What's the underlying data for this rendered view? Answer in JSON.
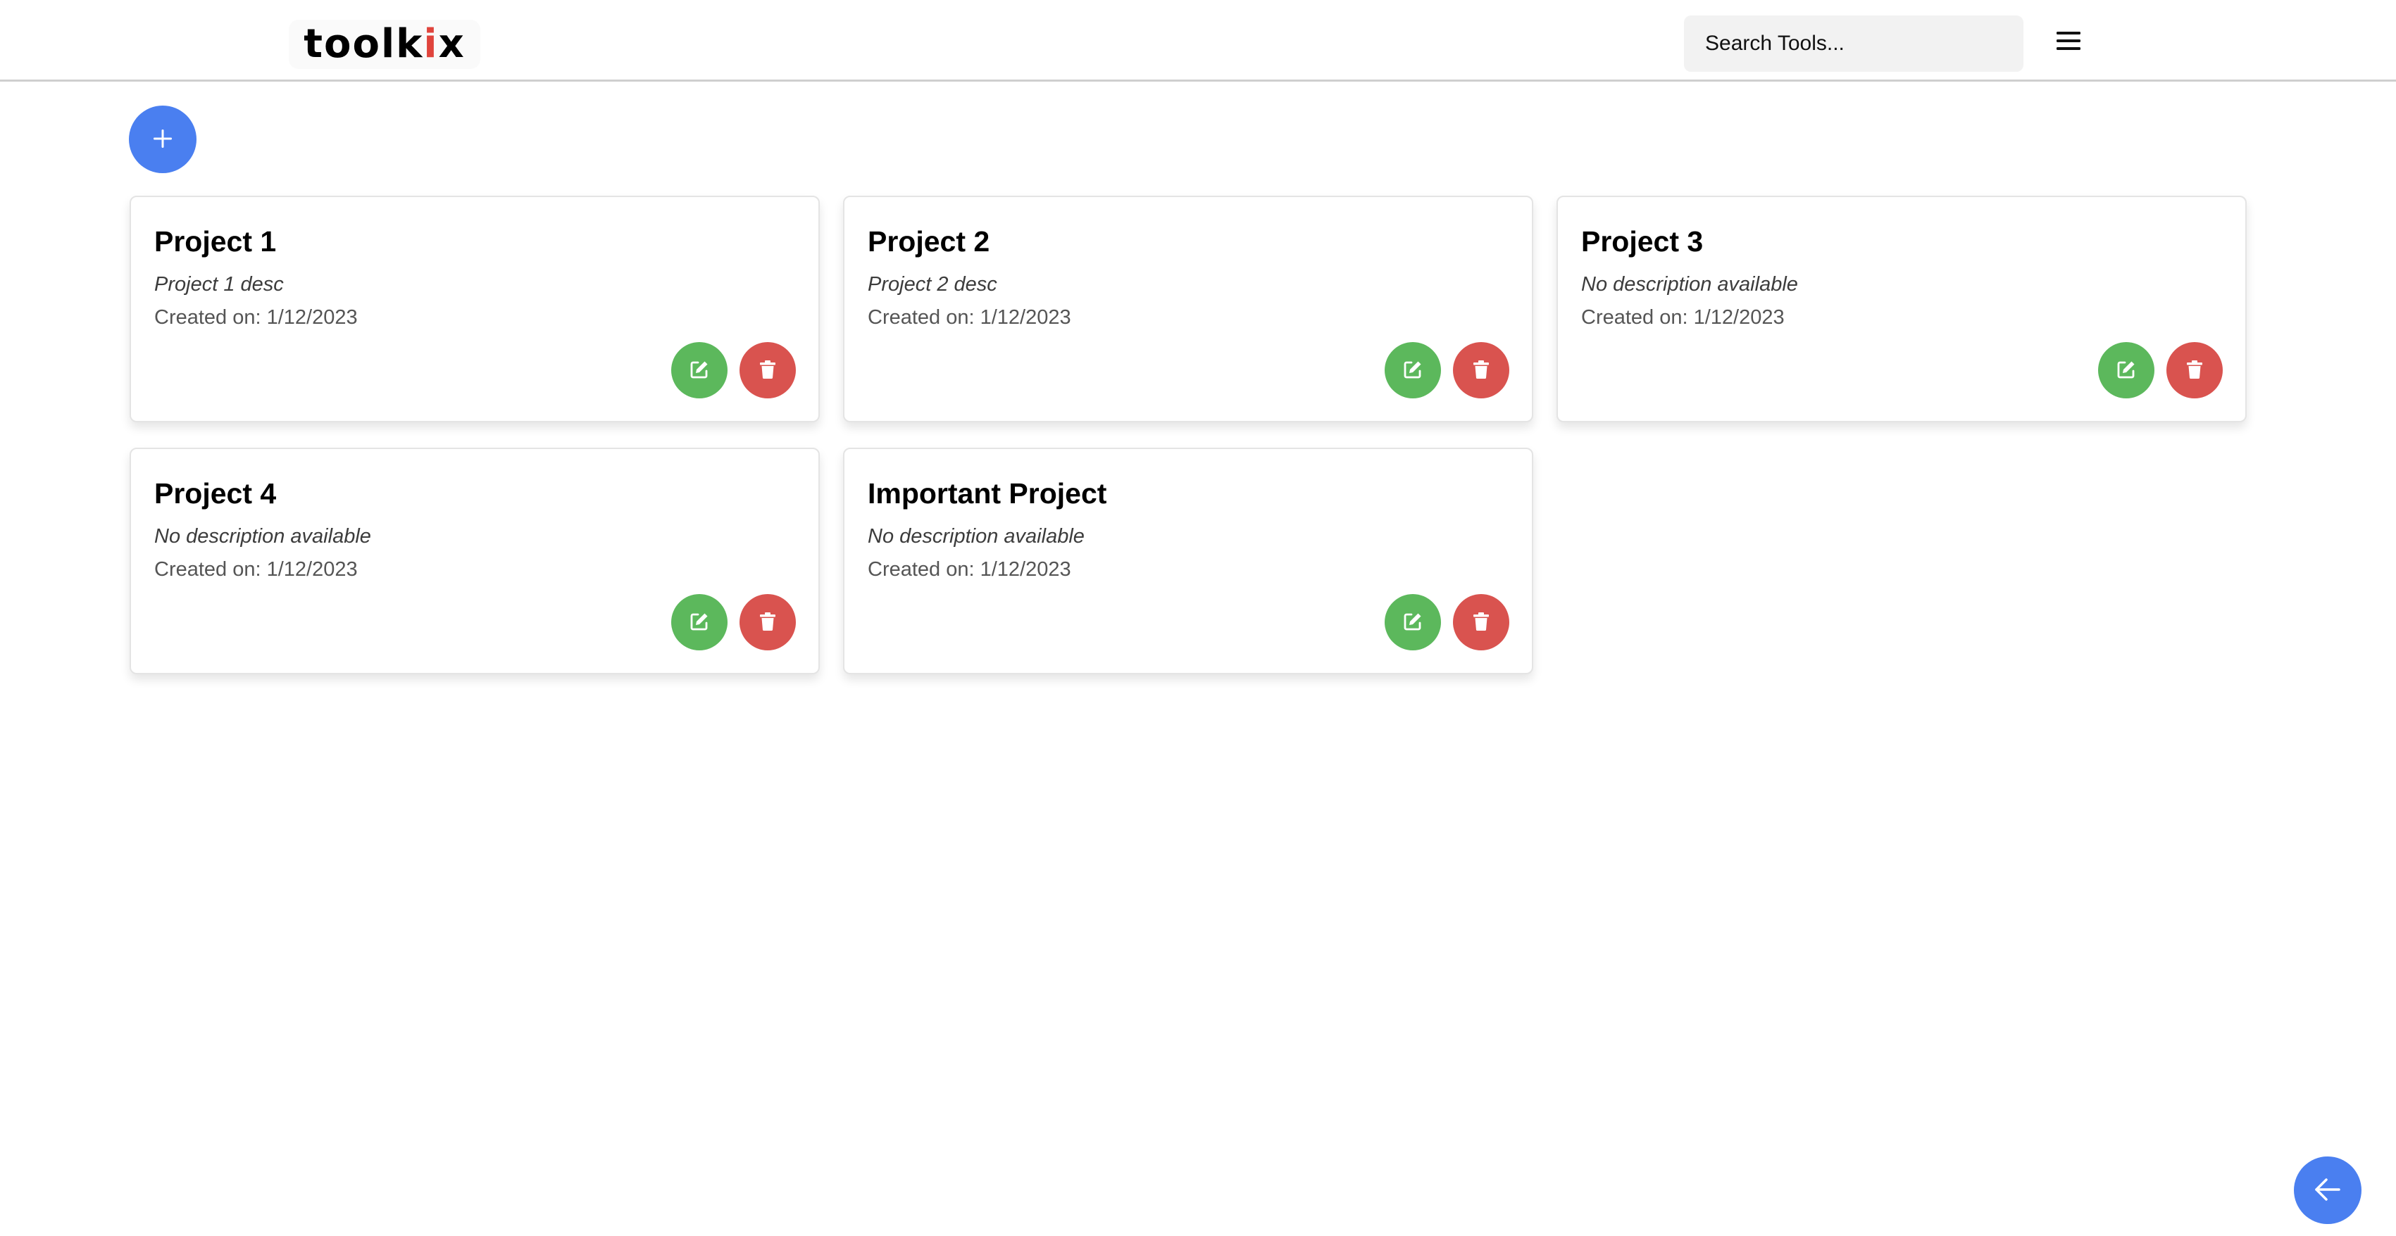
{
  "header": {
    "logo_main": "toolk",
    "logo_accent": "i",
    "logo_end": "x",
    "search_placeholder": "Search Tools...",
    "menu_icon": "hamburger-menu-icon"
  },
  "actions": {
    "add_icon": "plus-icon",
    "back_icon": "arrow-left-icon"
  },
  "colors": {
    "primary": "#4a7ff0",
    "edit": "#5cb85c",
    "delete": "#d9534f",
    "logo_accent": "#e0443c"
  },
  "projects": [
    {
      "title": "Project 1",
      "description": "Project 1 desc",
      "created_label": "Created on: ",
      "created_date": "1/12/2023"
    },
    {
      "title": "Project 2",
      "description": "Project 2 desc",
      "created_label": "Created on: ",
      "created_date": "1/12/2023"
    },
    {
      "title": "Project 3",
      "description": "No description available",
      "created_label": "Created on: ",
      "created_date": "1/12/2023"
    },
    {
      "title": "Project 4",
      "description": "No description available",
      "created_label": "Created on: ",
      "created_date": "1/12/2023"
    },
    {
      "title": "Important Project",
      "description": "No description available",
      "created_label": "Created on: ",
      "created_date": "1/12/2023"
    }
  ]
}
